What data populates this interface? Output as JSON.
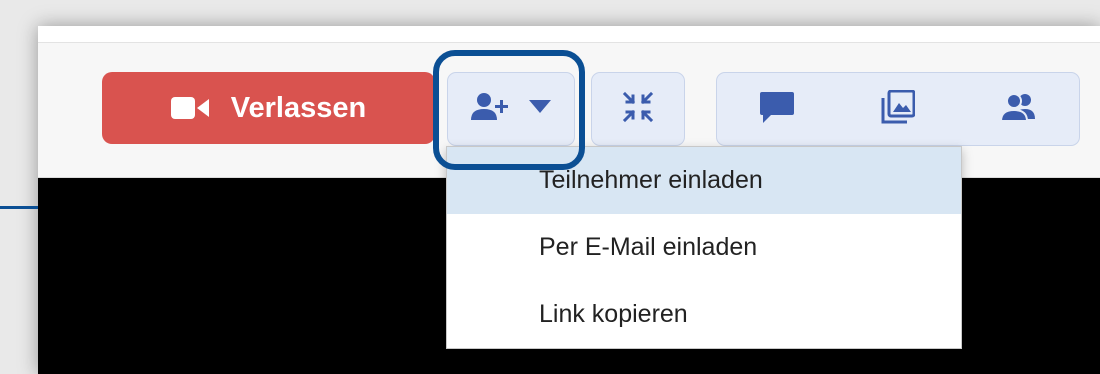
{
  "colors": {
    "leave_button": "#d9534f",
    "button_bg": "#e6ecf8",
    "icon_blue": "#3b5cad",
    "highlight_ring": "#0b4f94",
    "menu_active_bg": "#d8e6f3"
  },
  "toolbar": {
    "leave_label": "Verlassen",
    "leave_icon": "video-camera-icon",
    "invite_icon": "add-user-icon",
    "invite_dropdown_icon": "caret-down-icon",
    "fullscreen_icon": "compress-icon",
    "chat_icon": "chat-bubble-icon",
    "gallery_icon": "image-gallery-icon",
    "participants_icon": "users-icon"
  },
  "invite_menu": {
    "items": [
      {
        "label": "Teilnehmer einladen",
        "active": true
      },
      {
        "label": "Per E-Mail einladen",
        "active": false
      },
      {
        "label": "Link kopieren",
        "active": false
      }
    ]
  }
}
